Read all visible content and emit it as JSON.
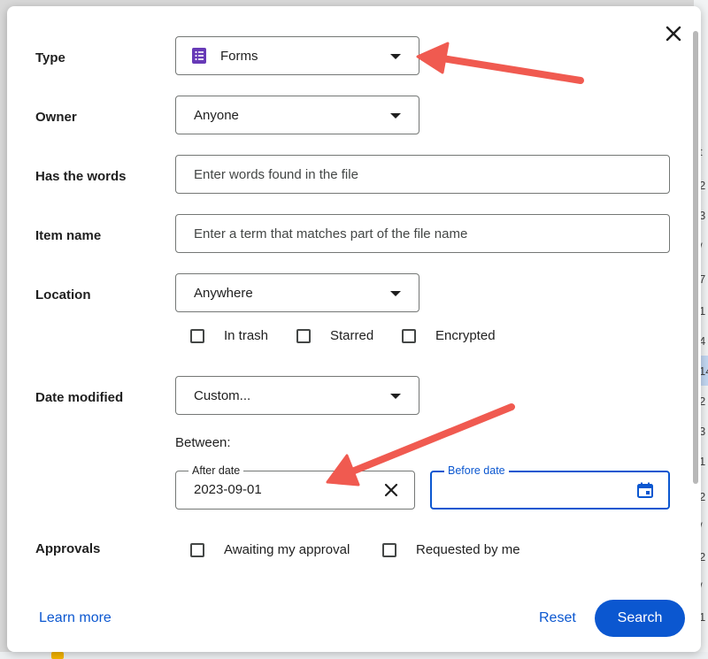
{
  "background": {
    "strip_cells": [
      "t",
      "2",
      "3",
      "/",
      "7",
      "1",
      "4",
      "8",
      "1",
      "14",
      "2",
      "3",
      "1",
      "2",
      "/",
      "2",
      "/",
      "1",
      "2"
    ]
  },
  "dialog": {
    "fields": {
      "type": {
        "label": "Type",
        "value": "Forms",
        "icon": "forms-icon",
        "icon_color": "#673ab7"
      },
      "owner": {
        "label": "Owner",
        "value": "Anyone"
      },
      "has_words": {
        "label": "Has the words",
        "placeholder": "Enter words found in the file",
        "value": ""
      },
      "item_name": {
        "label": "Item name",
        "placeholder": "Enter a term that matches part of the file name",
        "value": ""
      },
      "location": {
        "label": "Location",
        "value": "Anywhere",
        "options": [
          "In trash",
          "Starred",
          "Encrypted"
        ]
      },
      "date_modified": {
        "label": "Date modified",
        "value": "Custom...",
        "between_label": "Between:",
        "after": {
          "legend": "After date",
          "value": "2023-09-01"
        },
        "before": {
          "legend": "Before date",
          "value": ""
        }
      },
      "approvals": {
        "label": "Approvals",
        "options": [
          "Awaiting my approval",
          "Requested by me"
        ]
      }
    },
    "footer": {
      "learn_more": "Learn more",
      "reset": "Reset",
      "search": "Search"
    }
  },
  "colors": {
    "accent": "#0b57d0",
    "annotation_arrow": "#f05a50",
    "focus_border": "#0b57d0"
  }
}
